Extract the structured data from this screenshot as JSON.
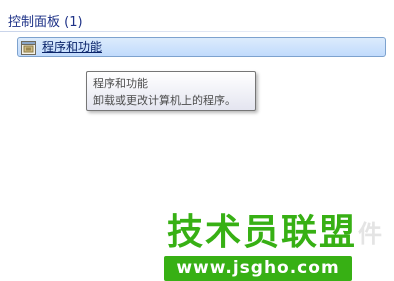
{
  "search_results": {
    "group_header": "控制面板 (1)",
    "items": [
      {
        "label": "程序和功能",
        "icon": "programs-and-features-icon"
      }
    ]
  },
  "tooltip": {
    "title": "程序和功能",
    "description": "卸载或更改计算机上的程序。"
  },
  "watermark": {
    "title": "技术员联盟",
    "extra": "件",
    "url": "www.jsgho.com",
    "brand_color": "#37b014"
  },
  "colors": {
    "header_text": "#1e3287",
    "selection_border": "#7da2ce",
    "selection_fill": "#c1dbfc"
  }
}
